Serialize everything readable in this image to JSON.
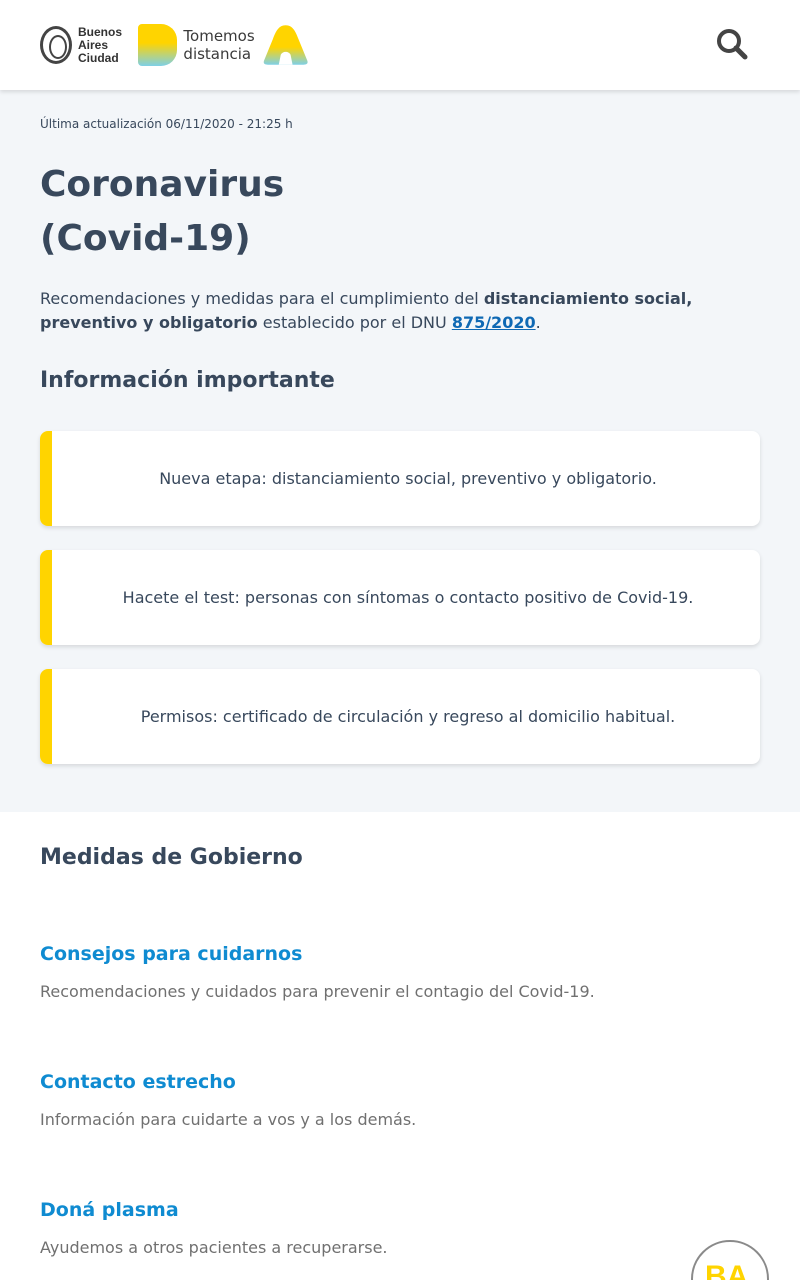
{
  "header": {
    "ba_logo_lines": [
      "Buenos",
      "Aires",
      "Ciudad"
    ],
    "tomemos_lines": [
      "Tomemos",
      "distancia"
    ],
    "search_icon": "search-icon"
  },
  "hero": {
    "updated": "Última actualización 06/11/2020 - 21:25 h",
    "title_line1": "Coronavirus",
    "title_line2": "(Covid-19)",
    "lead_part1": "Recomendaciones y medidas para el cumplimiento del ",
    "lead_bold": "distanciamiento social, preventivo y obligatorio",
    "lead_part2": " establecido por el DNU ",
    "lead_link": "875/2020",
    "lead_end": "."
  },
  "important": {
    "heading": "Información importante",
    "cards": [
      {
        "text": "Nueva etapa: distanciamiento social, preventivo y obligatorio."
      },
      {
        "text": "Hacete el test: personas con síntomas o contacto positivo de Covid-19."
      },
      {
        "text": "Permisos: certificado de circulación y regreso al domicilio habitual."
      }
    ]
  },
  "measures": {
    "heading": "Medidas de Gobierno",
    "items": [
      {
        "title": "Consejos para cuidarnos",
        "desc": "Recomendaciones y cuidados para prevenir el contagio del Covid-19."
      },
      {
        "title": "Contacto estrecho",
        "desc": "Información para cuidarte a vos y a los demás."
      },
      {
        "title": "Doná plasma",
        "desc": "Ayudemos a otros pacientes a recuperarse."
      }
    ]
  },
  "floating": {
    "letters": "BA"
  },
  "colors": {
    "accent_yellow": "#ffd400",
    "link_blue": "#0f8bd1",
    "text_dark": "#38485c"
  }
}
